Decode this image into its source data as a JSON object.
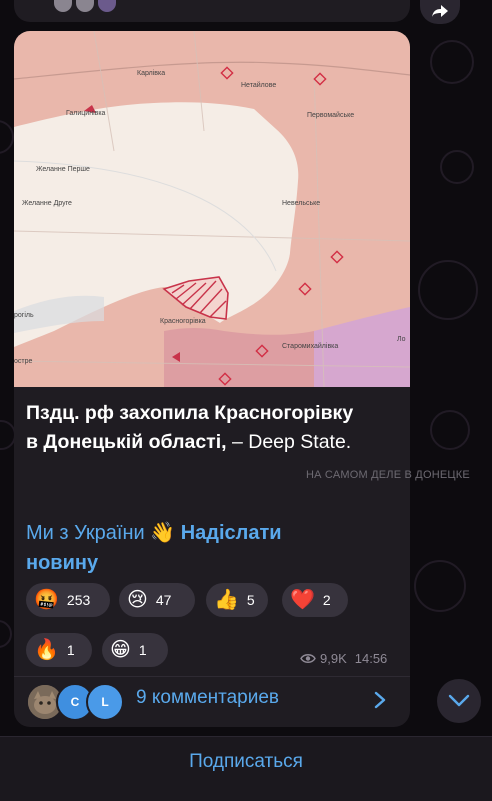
{
  "post": {
    "headline_bold": "Пздц. рф захопила Красногорівку в Донецькій області,",
    "headline_plain": " – Deep State.",
    "link1": "Ми з України",
    "link1_emoji": "👋",
    "link2": "Надіслати новину",
    "watermark": "НА САМОМ ДЕЛЕ В ДОНЕЦКЕ",
    "views": "9,9K",
    "time": "14:56"
  },
  "map": {
    "labels": {
      "karlivka": "Карлівка",
      "netaylove": "Нетайлове",
      "pervomaiske": "Первомайське",
      "halytsynivka": "Галицинівка",
      "zhelanne_pershe": "Желанне Перше",
      "zhelanne_druhe": "Желанне Друге",
      "nevelske": "Невельське",
      "krasnohorivka": "Красногорівка",
      "staromykhailivka": "Старомихайлівка",
      "rodynske_partial": "рогіль",
      "ostrog_partial": "остре",
      "lo_partial": "Ло"
    },
    "colors": {
      "occupied": "#e8b3a8",
      "contested": "#f4ece6",
      "occupied_old": "#d99aa0",
      "occupied_pink": "#d6a7cf",
      "marker": "#d22f45"
    }
  },
  "reactions": [
    {
      "emoji": "🤬",
      "count": "253"
    },
    {
      "emoji": "😢",
      "count": "47"
    },
    {
      "emoji": "👍",
      "count": "5"
    },
    {
      "emoji": "❤️",
      "count": "2"
    },
    {
      "emoji": "🔥",
      "count": "1"
    },
    {
      "emoji": "😁",
      "count": "1"
    }
  ],
  "comments": {
    "label": "9 комментариев",
    "avatar2_initial": "C",
    "avatar3_initial": "L",
    "avatar_colors": [
      "#8a7a6a",
      "#3f8fe0",
      "#4a9ae8"
    ]
  },
  "subscribe_label": "Подписаться"
}
